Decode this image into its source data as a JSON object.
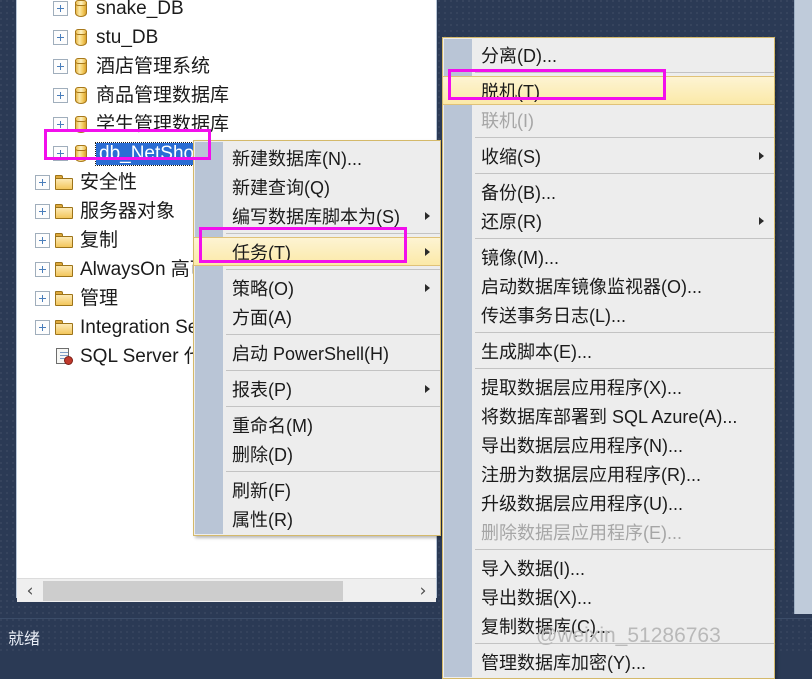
{
  "theme": {
    "window_bg": "#2b3a55",
    "panel_bg": "#ffffff",
    "menu_bg": "#ededed",
    "menu_border": "#d4b96a",
    "menu_gutter": "#b9c5d6",
    "highlight_box": "#f20fec",
    "menu_hover": "#fbe9a8",
    "selection_blue": "#2a6dd4",
    "disabled_text": "#a6a6a6"
  },
  "tree": {
    "name": "object-explorer",
    "items": [
      {
        "label": "snake_DB",
        "icon": "database-icon",
        "depth": 2,
        "expandable": true,
        "selected": false
      },
      {
        "label": "stu_DB",
        "icon": "database-icon",
        "depth": 2,
        "expandable": true,
        "selected": false
      },
      {
        "label": "酒店管理系统",
        "icon": "database-icon",
        "depth": 2,
        "expandable": true,
        "selected": false
      },
      {
        "label": "商品管理数据库",
        "icon": "database-icon",
        "depth": 2,
        "expandable": true,
        "selected": false
      },
      {
        "label": "学生管理数据库",
        "icon": "database-icon",
        "depth": 2,
        "expandable": true,
        "selected": false
      },
      {
        "label": "db_NetShop",
        "icon": "database-icon",
        "depth": 2,
        "expandable": true,
        "selected": true
      },
      {
        "label": "安全性",
        "icon": "folder-icon",
        "depth": 1,
        "expandable": true,
        "selected": false
      },
      {
        "label": "服务器对象",
        "icon": "folder-icon",
        "depth": 1,
        "expandable": true,
        "selected": false
      },
      {
        "label": "复制",
        "icon": "folder-icon",
        "depth": 1,
        "expandable": true,
        "selected": false
      },
      {
        "label": "AlwaysOn 高可",
        "icon": "folder-icon",
        "depth": 1,
        "expandable": true,
        "selected": false
      },
      {
        "label": "管理",
        "icon": "folder-icon",
        "depth": 1,
        "expandable": true,
        "selected": false
      },
      {
        "label": "Integration Se",
        "icon": "folder-icon",
        "depth": 1,
        "expandable": true,
        "selected": false
      },
      {
        "label": "SQL Server 代理",
        "icon": "sql-agent-icon",
        "depth": 1,
        "expandable": false,
        "selected": false
      }
    ],
    "hscroll": {
      "left_arrow": "‹",
      "right_arrow": "›"
    }
  },
  "context_menu": {
    "name": "database-context-menu",
    "items": [
      {
        "label": "新建数据库(N)...",
        "type": "item",
        "submenu": false
      },
      {
        "label": "新建查询(Q)",
        "type": "item",
        "submenu": false
      },
      {
        "label": "编写数据库脚本为(S)",
        "type": "item",
        "submenu": true
      },
      {
        "label": "",
        "type": "separator",
        "submenu": false
      },
      {
        "label": "任务(T)",
        "type": "item",
        "submenu": true,
        "highlighted": true
      },
      {
        "label": "",
        "type": "separator",
        "submenu": false
      },
      {
        "label": "策略(O)",
        "type": "item",
        "submenu": true
      },
      {
        "label": "方面(A)",
        "type": "item",
        "submenu": false
      },
      {
        "label": "",
        "type": "separator",
        "submenu": false
      },
      {
        "label": "启动 PowerShell(H)",
        "type": "item",
        "submenu": false
      },
      {
        "label": "",
        "type": "separator",
        "submenu": false
      },
      {
        "label": "报表(P)",
        "type": "item",
        "submenu": true
      },
      {
        "label": "",
        "type": "separator",
        "submenu": false
      },
      {
        "label": "重命名(M)",
        "type": "item",
        "submenu": false
      },
      {
        "label": "删除(D)",
        "type": "item",
        "submenu": false
      },
      {
        "label": "",
        "type": "separator",
        "submenu": false
      },
      {
        "label": "刷新(F)",
        "type": "item",
        "submenu": false
      },
      {
        "label": "属性(R)",
        "type": "item",
        "submenu": false
      }
    ]
  },
  "tasks_submenu": {
    "name": "tasks-submenu",
    "items": [
      {
        "label": "分离(D)...",
        "type": "item",
        "submenu": false
      },
      {
        "label": "",
        "type": "separator",
        "submenu": false
      },
      {
        "label": "脱机(T)",
        "type": "item",
        "submenu": false,
        "highlighted": true
      },
      {
        "label": "联机(I)",
        "type": "item",
        "submenu": false,
        "disabled": true
      },
      {
        "label": "",
        "type": "separator",
        "submenu": false
      },
      {
        "label": "收缩(S)",
        "type": "item",
        "submenu": true
      },
      {
        "label": "",
        "type": "separator",
        "submenu": false
      },
      {
        "label": "备份(B)...",
        "type": "item",
        "submenu": false
      },
      {
        "label": "还原(R)",
        "type": "item",
        "submenu": true
      },
      {
        "label": "",
        "type": "separator",
        "submenu": false
      },
      {
        "label": "镜像(M)...",
        "type": "item",
        "submenu": false
      },
      {
        "label": "启动数据库镜像监视器(O)...",
        "type": "item",
        "submenu": false
      },
      {
        "label": "传送事务日志(L)...",
        "type": "item",
        "submenu": false
      },
      {
        "label": "",
        "type": "separator",
        "submenu": false
      },
      {
        "label": "生成脚本(E)...",
        "type": "item",
        "submenu": false
      },
      {
        "label": "",
        "type": "separator",
        "submenu": false
      },
      {
        "label": "提取数据层应用程序(X)...",
        "type": "item",
        "submenu": false
      },
      {
        "label": "将数据库部署到 SQL Azure(A)...",
        "type": "item",
        "submenu": false
      },
      {
        "label": "导出数据层应用程序(N)...",
        "type": "item",
        "submenu": false
      },
      {
        "label": "注册为数据层应用程序(R)...",
        "type": "item",
        "submenu": false
      },
      {
        "label": "升级数据层应用程序(U)...",
        "type": "item",
        "submenu": false
      },
      {
        "label": "删除数据层应用程序(E)...",
        "type": "item",
        "submenu": false,
        "disabled": true
      },
      {
        "label": "",
        "type": "separator",
        "submenu": false
      },
      {
        "label": "导入数据(I)...",
        "type": "item",
        "submenu": false
      },
      {
        "label": "导出数据(X)...",
        "type": "item",
        "submenu": false
      },
      {
        "label": "复制数据库(C)...",
        "type": "item",
        "submenu": false
      },
      {
        "label": "",
        "type": "separator",
        "submenu": false
      },
      {
        "label": "管理数据库加密(Y)...",
        "type": "item",
        "submenu": false
      }
    ]
  },
  "status_bar": {
    "text": "就绪"
  },
  "watermark": {
    "text": "@weixin_51286763"
  }
}
